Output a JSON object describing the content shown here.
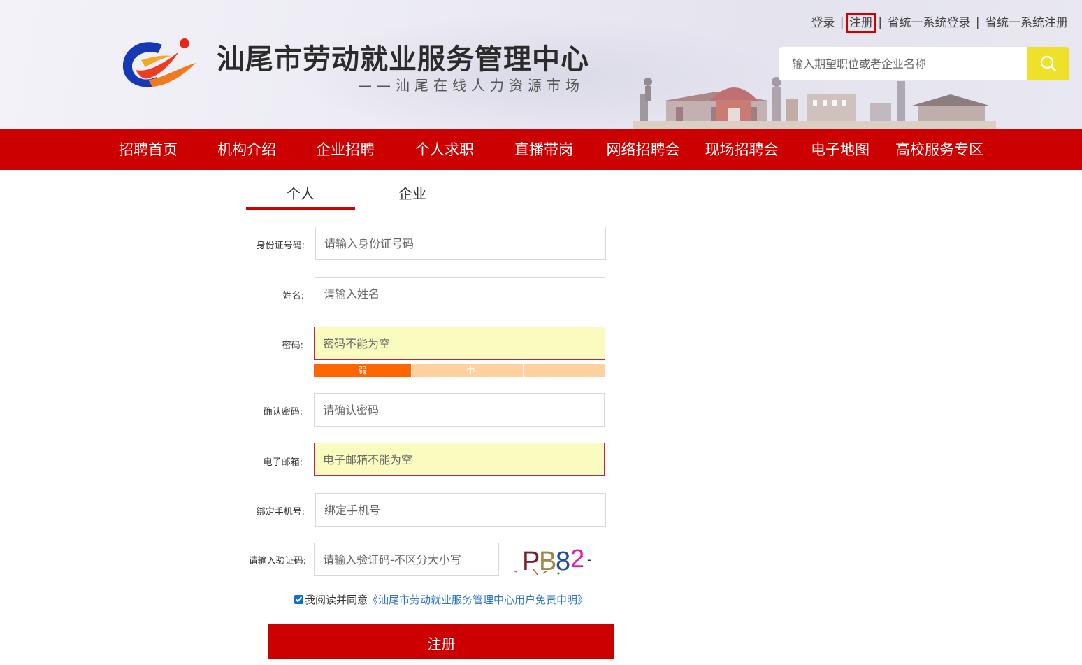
{
  "header": {
    "site_title": "汕尾市劳动就业服务管理中心",
    "site_subtitle": "——汕尾在线人力资源市场",
    "top_links": [
      "登录",
      "注册",
      "省统一系统登录",
      "省统一系统注册"
    ],
    "search": {
      "placeholder": "输入期望职位或者企业名称"
    }
  },
  "nav": {
    "items": [
      "招聘首页",
      "机构介绍",
      "企业招聘",
      "个人求职",
      "直播带岗",
      "网络招聘会",
      "现场招聘会",
      "电子地图",
      "高校服务专区"
    ]
  },
  "tabs": [
    {
      "label": "个人",
      "active": true
    },
    {
      "label": "企业",
      "active": false
    }
  ],
  "form": {
    "id_number": {
      "label": "身份证号码:",
      "placeholder": "请输入身份证号码"
    },
    "name": {
      "label": "姓名:",
      "placeholder": "请输入姓名"
    },
    "password": {
      "label": "密码:",
      "placeholder": "密码不能为空",
      "error": true
    },
    "password_strength": {
      "levels": [
        "弱",
        "中",
        ""
      ],
      "current": "弱"
    },
    "confirm_password": {
      "label": "确认密码:",
      "placeholder": "请确认密码"
    },
    "email": {
      "label": "电子邮箱:",
      "placeholder": "电子邮箱不能为空",
      "error": true
    },
    "phone": {
      "label": "绑定手机号:",
      "placeholder": "绑定手机号"
    },
    "captcha": {
      "label": "请输入验证码:",
      "placeholder": "请输入验证码-不区分大小写",
      "image_text": "PB82"
    },
    "agreement": {
      "checked": true,
      "prefix": "我阅读并同意",
      "link": "《汕尾市劳动就业服务管理中心用户免责申明》"
    },
    "submit_label": "注册"
  },
  "colors": {
    "brand_red": "#cc0000",
    "search_button": "#efe02a",
    "error_border": "#c0224a",
    "error_bg": "#fafcbf",
    "weak": "#ff6600",
    "strength_bg": "#ffd19e",
    "link": "#2a74c8"
  }
}
